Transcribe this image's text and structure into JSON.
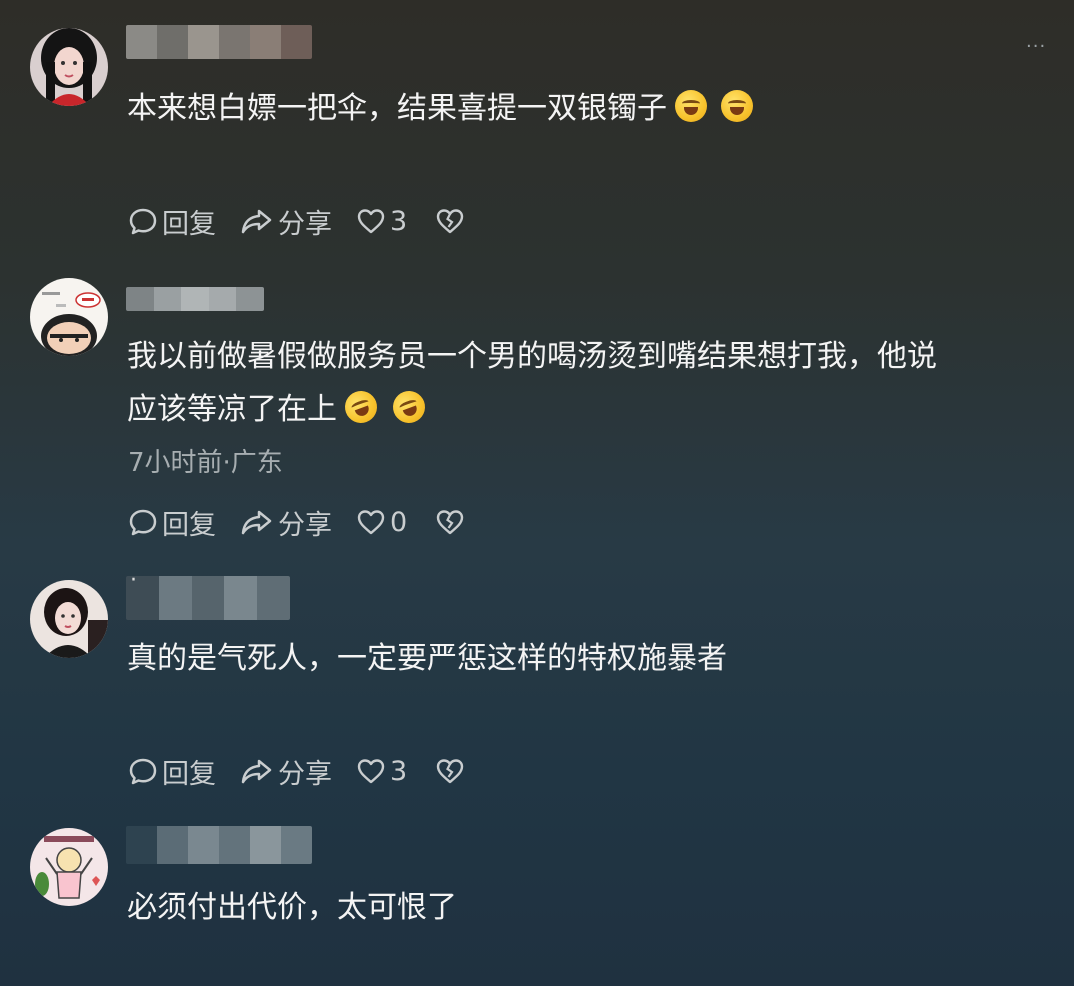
{
  "more_label": "···",
  "comments": [
    {
      "text": "本来想白嫖一把伞，结果喜提一双银镯子",
      "emojis": [
        "cry-laugh",
        "cry-laugh"
      ],
      "meta": "",
      "reply_label": "回复",
      "share_label": "分享",
      "like_count": "3"
    },
    {
      "text_line1": "我以前做暑假做服务员一个男的喝汤烫到嘴结果想打我，他说",
      "text_line2": "应该等凉了在上",
      "emojis": [
        "rolling-laugh",
        "rolling-laugh"
      ],
      "meta": "7小时前·广东",
      "reply_label": "回复",
      "share_label": "分享",
      "like_count": "0"
    },
    {
      "text": "真的是气死人，一定要严惩这样的特权施暴者",
      "meta": "",
      "reply_label": "回复",
      "share_label": "分享",
      "like_count": "3"
    },
    {
      "text": "必须付出代价，太可恨了",
      "meta": ""
    }
  ],
  "colors": {
    "text": "#f4f4f4",
    "meta": "#a7aeb1",
    "action": "#c9cdcf"
  }
}
